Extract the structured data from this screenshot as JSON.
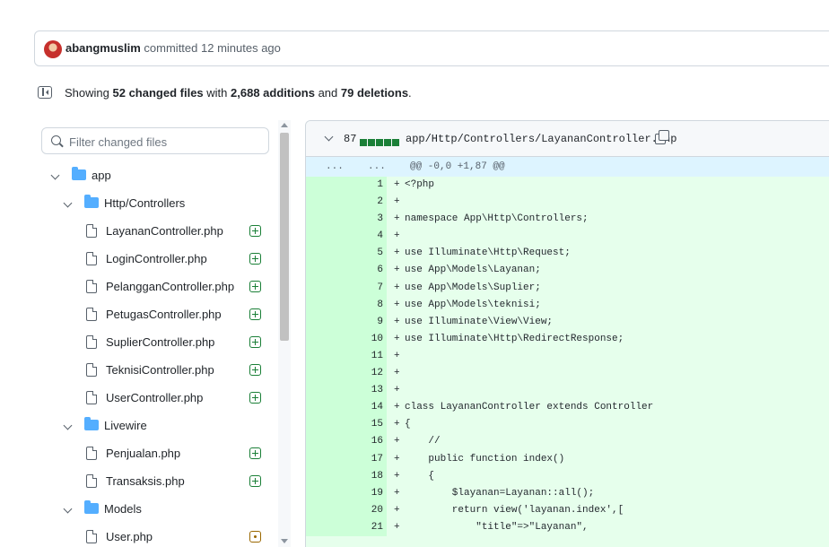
{
  "commit": {
    "author": "abangmuslim",
    "action": "committed 12 minutes ago"
  },
  "summary": {
    "prefix": "Showing",
    "changed_files": "52 changed files",
    "with": "with",
    "additions": "2,688 additions",
    "and": "and",
    "deletions": "79 deletions",
    "period": "."
  },
  "filter": {
    "placeholder": "Filter changed files"
  },
  "tree": [
    {
      "kind": "folder",
      "label": "app",
      "depth": 0
    },
    {
      "kind": "folder",
      "label": "Http/Controllers",
      "depth": 1
    },
    {
      "kind": "file",
      "label": "LayananController.php",
      "status": "added"
    },
    {
      "kind": "file",
      "label": "LoginController.php",
      "status": "added"
    },
    {
      "kind": "file",
      "label": "PelangganController.php",
      "status": "added"
    },
    {
      "kind": "file",
      "label": "PetugasController.php",
      "status": "added"
    },
    {
      "kind": "file",
      "label": "SuplierController.php",
      "status": "added"
    },
    {
      "kind": "file",
      "label": "TeknisiController.php",
      "status": "added"
    },
    {
      "kind": "file",
      "label": "UserController.php",
      "status": "added"
    },
    {
      "kind": "folder",
      "label": "Livewire",
      "depth": 1
    },
    {
      "kind": "file",
      "label": "Penjualan.php",
      "status": "added"
    },
    {
      "kind": "file",
      "label": "Transaksis.php",
      "status": "added"
    },
    {
      "kind": "folder",
      "label": "Models",
      "depth": 1
    },
    {
      "kind": "file",
      "label": "User.php",
      "status": "modified"
    }
  ],
  "diff": {
    "count": "87",
    "path": "app/Http/Controllers/LayananController.php",
    "hunk": {
      "old": "...",
      "new": "...",
      "text": "@@ -0,0 +1,87 @@"
    },
    "lines": [
      {
        "no": "1",
        "code": "<?php"
      },
      {
        "no": "2",
        "code": ""
      },
      {
        "no": "3",
        "code": "namespace App\\Http\\Controllers;"
      },
      {
        "no": "4",
        "code": ""
      },
      {
        "no": "5",
        "code": "use Illuminate\\Http\\Request;"
      },
      {
        "no": "6",
        "code": "use App\\Models\\Layanan;"
      },
      {
        "no": "7",
        "code": "use App\\Models\\Suplier;"
      },
      {
        "no": "8",
        "code": "use App\\Models\\teknisi;"
      },
      {
        "no": "9",
        "code": "use Illuminate\\View\\View;"
      },
      {
        "no": "10",
        "code": "use Illuminate\\Http\\RedirectResponse;"
      },
      {
        "no": "11",
        "code": ""
      },
      {
        "no": "12",
        "code": ""
      },
      {
        "no": "13",
        "code": ""
      },
      {
        "no": "14",
        "code": "class LayananController extends Controller"
      },
      {
        "no": "15",
        "code": "{"
      },
      {
        "no": "16",
        "code": "    //"
      },
      {
        "no": "17",
        "code": "    public function index()"
      },
      {
        "no": "18",
        "code": "    {"
      },
      {
        "no": "19",
        "code": "        $layanan=Layanan::all();"
      },
      {
        "no": "20",
        "code": "        return view('layanan.index',["
      },
      {
        "no": "21",
        "code": "            \"title\"=>\"Layanan\","
      }
    ]
  }
}
